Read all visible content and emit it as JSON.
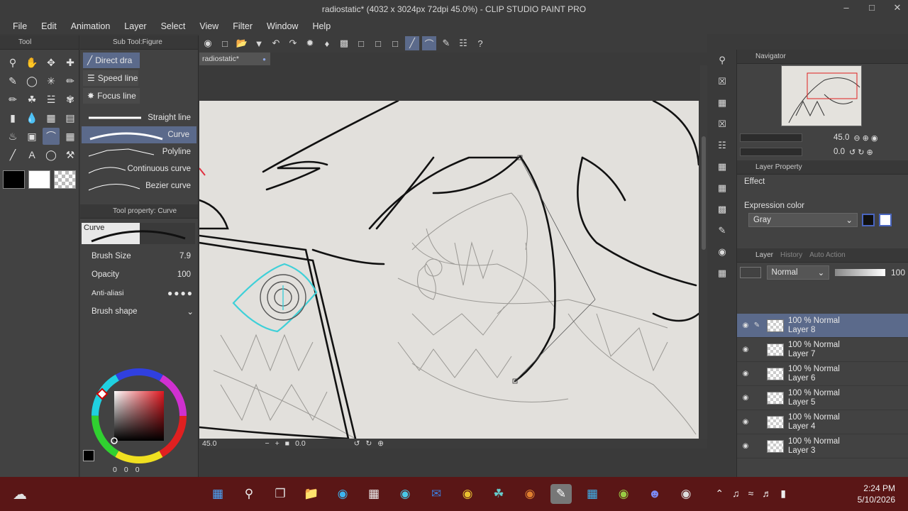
{
  "window": {
    "title": "radiostatic* (4032 x 3024px 72dpi 45.0%)  - CLIP STUDIO PAINT PRO"
  },
  "menu": [
    "File",
    "Edit",
    "Animation",
    "Layer",
    "Select",
    "View",
    "Filter",
    "Window",
    "Help"
  ],
  "tool_panel": {
    "title": "Tool"
  },
  "subtool_panel": {
    "title": "Sub Tool:Figure",
    "tabs": [
      "Direct dra",
      "Speed line",
      "Focus line"
    ],
    "brushes": [
      "Straight line",
      "Curve",
      "Polyline",
      "Continuous curve",
      "Bezier curve"
    ],
    "selected_brush": "Curve"
  },
  "tool_property": {
    "title": "Tool property: Curve",
    "preview_label": "Curve",
    "brush_size_label": "Brush Size",
    "brush_size": "7.9",
    "opacity_label": "Opacity",
    "opacity": "100",
    "anti_alias_label": "Anti-aliasi",
    "brush_shape_label": "Brush shape"
  },
  "color_values": {
    "a": "0",
    "b": "0",
    "c": "0"
  },
  "document": {
    "tab_label": "radiostatic*"
  },
  "status": {
    "zoom": "45.0",
    "rotation": "0.0"
  },
  "navigator": {
    "title": "Navigator",
    "zoom": "45.0",
    "angle": "0.0"
  },
  "layer_property": {
    "title": "Layer Property",
    "effect_label": "Effect",
    "expression_color_label": "Expression color",
    "expression_color": "Gray"
  },
  "layer_panel": {
    "tabs": [
      "Layer",
      "History",
      "Auto Action"
    ],
    "blend_mode": "Normal",
    "opacity": "100",
    "layers": [
      {
        "mode": "100 % Normal",
        "name": "Layer 8",
        "selected": true
      },
      {
        "mode": "100 % Normal",
        "name": "Layer 7",
        "selected": false
      },
      {
        "mode": "100 % Normal",
        "name": "Layer 6",
        "selected": false
      },
      {
        "mode": "100 % Normal",
        "name": "Layer 5",
        "selected": false
      },
      {
        "mode": "100 % Normal",
        "name": "Layer 4",
        "selected": false
      },
      {
        "mode": "100 % Normal",
        "name": "Layer 3",
        "selected": false
      }
    ]
  },
  "taskbar": {
    "time": "2:24 PM",
    "date": "5/10/2026"
  },
  "colors": {
    "accent": "#5b6a8b",
    "taskbar": "#5a1616",
    "panel": "#424242",
    "cyan_stroke": "#3fd0d8"
  }
}
